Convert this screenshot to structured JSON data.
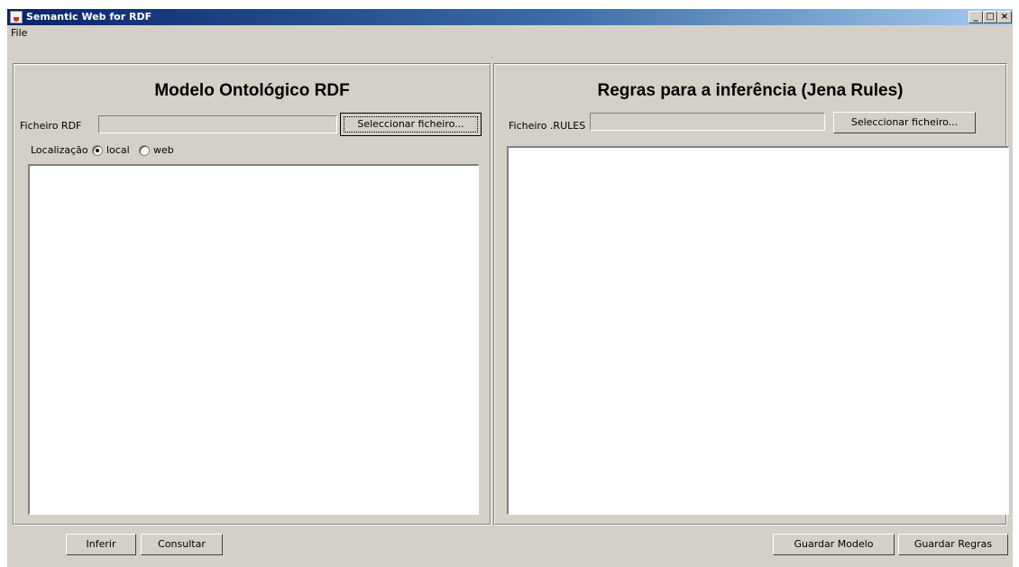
{
  "window": {
    "title": "Semantic Web for RDF",
    "icon": "java-cup-icon",
    "controls": {
      "minimize": "_",
      "maximize": "□",
      "close": "×"
    }
  },
  "menubar": {
    "items": [
      {
        "label": "File"
      }
    ]
  },
  "left_panel": {
    "title": "Modelo Ontológico RDF",
    "file_label": "Ficheiro RDF",
    "file_value": "",
    "select_button": "Seleccionar ficheiro...",
    "location_label": "Localização",
    "radio_local": "local",
    "radio_web": "web",
    "selected_location": "local",
    "text_content": ""
  },
  "right_panel": {
    "title": "Regras para a inferência (Jena Rules)",
    "file_label": "Ficheiro .RULES",
    "file_value": "",
    "select_button": "Seleccionar ficheiro...",
    "text_content": ""
  },
  "bottom_bar": {
    "infer": "Inferir",
    "query": "Consultar",
    "save_model": "Guardar Modelo",
    "save_rules": "Guardar Regras"
  }
}
